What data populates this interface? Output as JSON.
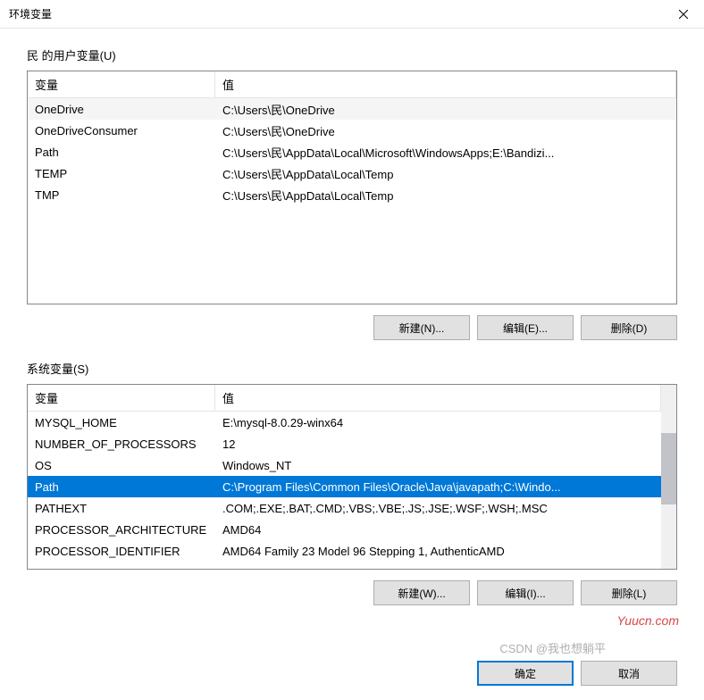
{
  "window": {
    "title": "环境变量"
  },
  "user_section": {
    "label": "民 的用户变量(U)",
    "headers": {
      "var": "变量",
      "val": "值"
    },
    "rows": [
      {
        "var": "OneDrive",
        "val": "C:\\Users\\民\\OneDrive"
      },
      {
        "var": "OneDriveConsumer",
        "val": "C:\\Users\\民\\OneDrive"
      },
      {
        "var": "Path",
        "val": "C:\\Users\\民\\AppData\\Local\\Microsoft\\WindowsApps;E:\\Bandizi..."
      },
      {
        "var": "TEMP",
        "val": "C:\\Users\\民\\AppData\\Local\\Temp"
      },
      {
        "var": "TMP",
        "val": "C:\\Users\\民\\AppData\\Local\\Temp"
      }
    ],
    "buttons": {
      "new": "新建(N)...",
      "edit": "编辑(E)...",
      "delete": "删除(D)"
    }
  },
  "system_section": {
    "label": "系统变量(S)",
    "headers": {
      "var": "变量",
      "val": "值"
    },
    "rows": [
      {
        "var": "MYSQL_HOME",
        "val": "E:\\mysql-8.0.29-winx64"
      },
      {
        "var": "NUMBER_OF_PROCESSORS",
        "val": "12"
      },
      {
        "var": "OS",
        "val": "Windows_NT"
      },
      {
        "var": "Path",
        "val": "C:\\Program Files\\Common Files\\Oracle\\Java\\javapath;C:\\Windo...",
        "selected": true
      },
      {
        "var": "PATHEXT",
        "val": ".COM;.EXE;.BAT;.CMD;.VBS;.VBE;.JS;.JSE;.WSF;.WSH;.MSC"
      },
      {
        "var": "PROCESSOR_ARCHITECTURE",
        "val": "AMD64"
      },
      {
        "var": "PROCESSOR_IDENTIFIER",
        "val": "AMD64 Family 23 Model 96 Stepping 1, AuthenticAMD"
      }
    ],
    "buttons": {
      "new": "新建(W)...",
      "edit": "编辑(I)...",
      "delete": "删除(L)"
    }
  },
  "footer": {
    "ok": "确定",
    "cancel": "取消"
  },
  "watermark": "Yuucn.com",
  "watermark2": "CSDN @我也想躺平"
}
